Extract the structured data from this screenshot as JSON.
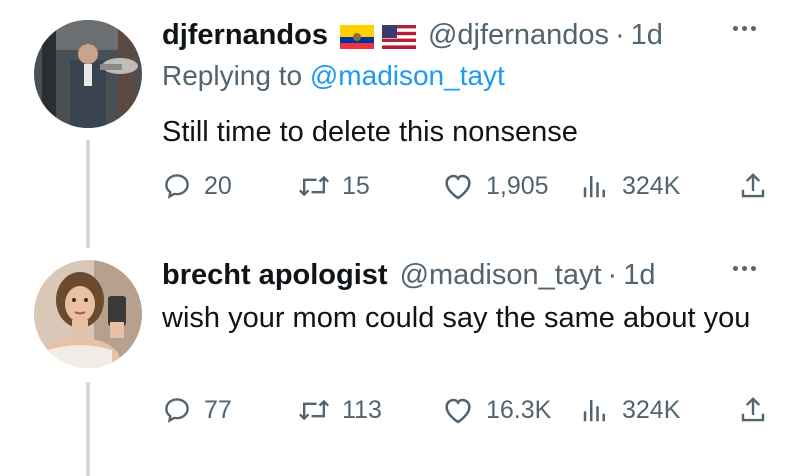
{
  "tweets": [
    {
      "display_name": "djfernandos",
      "handle": "@djfernandos",
      "separator": "·",
      "time": "1d",
      "replying_prefix": "Replying to",
      "replying_to": "@madison_tayt",
      "text": "Still time to delete this nonsense",
      "stats": {
        "replies": "20",
        "retweets": "15",
        "likes": "1,905",
        "views": "324K"
      },
      "flags": [
        "flag-ecuador-icon",
        "flag-usa-icon"
      ]
    },
    {
      "display_name": "brecht apologist",
      "handle": "@madison_tayt",
      "separator": "·",
      "time": "1d",
      "text": "wish your mom could say the same about you",
      "stats": {
        "replies": "77",
        "retweets": "113",
        "likes": "16.3K",
        "views": "324K"
      }
    }
  ],
  "colors": {
    "primary_text": "#0f1419",
    "secondary_text": "#536471",
    "link": "#1d9bf0",
    "thread_line": "#cfd9de"
  }
}
